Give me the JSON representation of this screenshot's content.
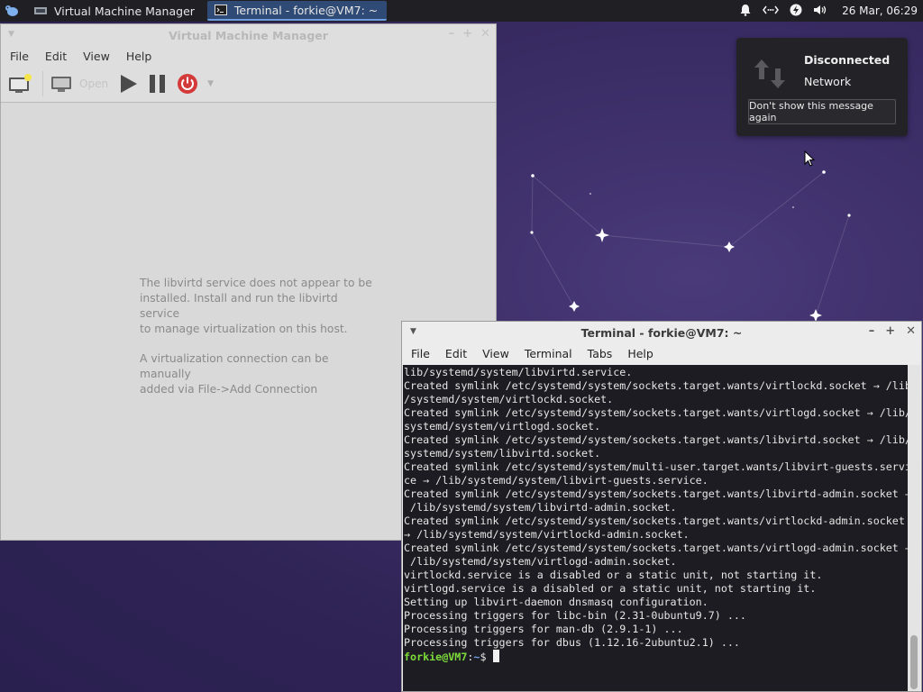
{
  "panel": {
    "tasks": [
      {
        "label": "Virtual Machine Manager",
        "active": false
      },
      {
        "label": "Terminal - forkie@VM7: ~",
        "active": true
      }
    ],
    "clock": "26 Mar, 06:29",
    "tray_icons": [
      "bell-icon",
      "network-icon",
      "power-icon",
      "volume-icon"
    ]
  },
  "notification": {
    "title": "Disconnected",
    "body": "Network",
    "button": "Don't show this message again"
  },
  "vmm": {
    "title": "Virtual Machine Manager",
    "menu": [
      "File",
      "Edit",
      "View",
      "Help"
    ],
    "toolbar": {
      "open_label": "Open"
    },
    "message_lines": [
      "The libvirtd service does not appear to be",
      "installed. Install and run the libvirtd service",
      "to manage virtualization on this host."
    ],
    "message2_lines": [
      "A virtualization connection can be manually",
      "added via File->Add Connection"
    ]
  },
  "terminal": {
    "title": "Terminal - forkie@VM7: ~",
    "menu": [
      "File",
      "Edit",
      "View",
      "Terminal",
      "Tabs",
      "Help"
    ],
    "lines": [
      "lib/systemd/system/libvirtd.service.",
      "Created symlink /etc/systemd/system/sockets.target.wants/virtlockd.socket → /lib",
      "/systemd/system/virtlockd.socket.",
      "Created symlink /etc/systemd/system/sockets.target.wants/virtlogd.socket → /lib/",
      "systemd/system/virtlogd.socket.",
      "Created symlink /etc/systemd/system/sockets.target.wants/libvirtd.socket → /lib/",
      "systemd/system/libvirtd.socket.",
      "Created symlink /etc/systemd/system/multi-user.target.wants/libvirt-guests.servi",
      "ce → /lib/systemd/system/libvirt-guests.service.",
      "Created symlink /etc/systemd/system/sockets.target.wants/libvirtd-admin.socket →",
      " /lib/systemd/system/libvirtd-admin.socket.",
      "Created symlink /etc/systemd/system/sockets.target.wants/virtlockd-admin.socket",
      "→ /lib/systemd/system/virtlockd-admin.socket.",
      "Created symlink /etc/systemd/system/sockets.target.wants/virtlogd-admin.socket →",
      " /lib/systemd/system/virtlogd-admin.socket.",
      "virtlockd.service is a disabled or a static unit, not starting it.",
      "virtlogd.service is a disabled or a static unit, not starting it.",
      "Setting up libvirt-daemon dnsmasq configuration.",
      "Processing triggers for libc-bin (2.31-0ubuntu9.7) ...",
      "Processing triggers for man-db (2.9.1-1) ...",
      "Processing triggers for dbus (1.12.16-2ubuntu2.1) ..."
    ],
    "prompt_user": "forkie@VM7",
    "prompt_sep": ":",
    "prompt_path": "~",
    "prompt_symbol": "$ "
  }
}
